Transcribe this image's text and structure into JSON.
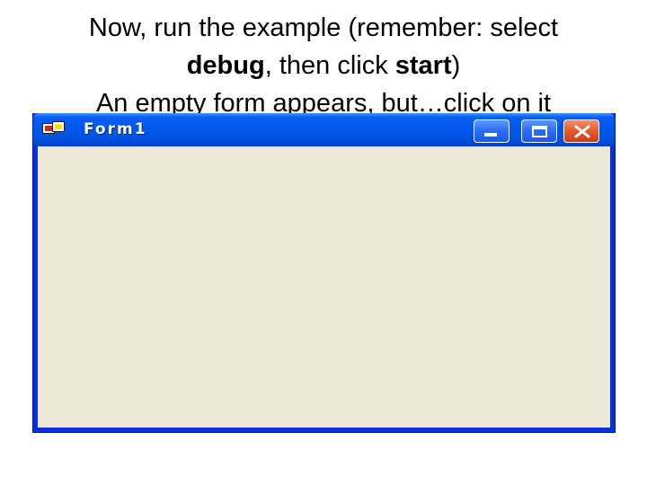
{
  "caption": {
    "line1": "Now, run the example (remember: select",
    "line2_bold1": "debug",
    "line2_mid": ", then click ",
    "line2_bold2": "start",
    "line2_end": ")",
    "line3": "An empty form appears, but…click on it"
  },
  "window": {
    "title": "Form1",
    "icon": "form-app-icon",
    "controls": [
      "minimize-icon",
      "maximize-icon",
      "close-icon"
    ],
    "colors": {
      "titlebar": "#0058ee",
      "client": "#ece9d8",
      "close_button": "#e35a2e"
    }
  }
}
